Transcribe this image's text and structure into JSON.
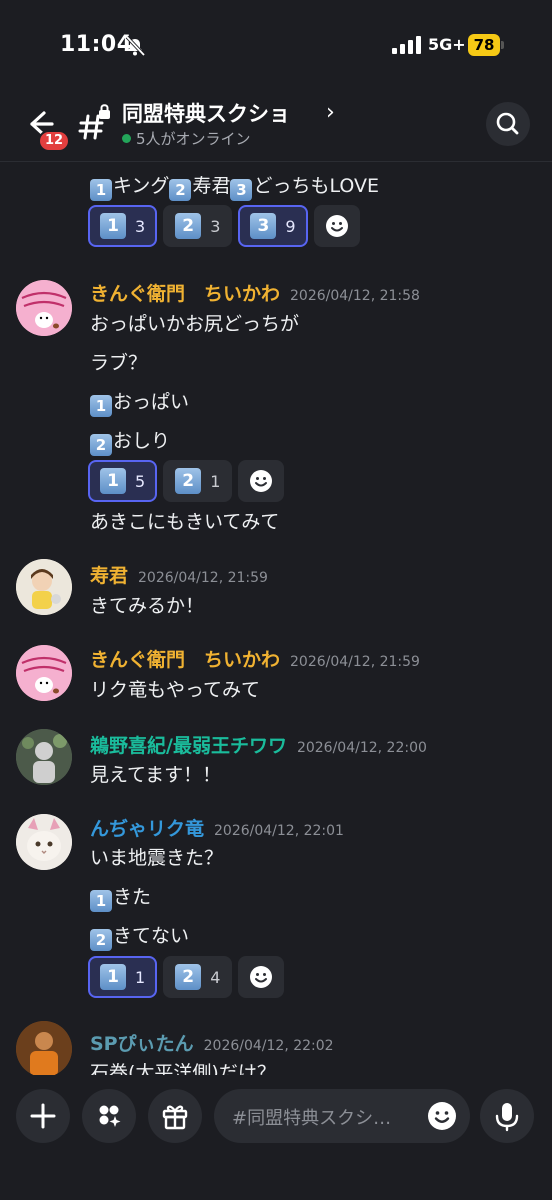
{
  "status": {
    "time": "11:04",
    "network": "5G+",
    "battery": "78"
  },
  "header": {
    "channel": "同盟特典スクショ",
    "chevron": "›",
    "online": "5人がオンライン",
    "badge": "12"
  },
  "messages": {
    "poll1": {
      "text_parts": [
        "キング",
        "寿君",
        "どっちもLOVE"
      ],
      "nums": [
        "1",
        "2",
        "3"
      ],
      "reactions": [
        {
          "n": "1",
          "count": "3",
          "me": true
        },
        {
          "n": "2",
          "count": "3",
          "me": false
        },
        {
          "n": "3",
          "count": "9",
          "me": true
        }
      ]
    },
    "m1": {
      "author": "きんぐ衛門　ちいかわ",
      "author_color": "#f0b232",
      "time": "2026/04/12, 21:58",
      "lines": [
        "おっぱいかお尻どっちが",
        "ラブ？",
        "おっぱい",
        "おしり"
      ],
      "nums": [
        "1",
        "2"
      ],
      "reactions": [
        {
          "n": "1",
          "count": "5",
          "me": true
        },
        {
          "n": "2",
          "count": "1",
          "me": false
        }
      ],
      "after": "あきこにもきいてみて"
    },
    "m2": {
      "author": "寿君",
      "author_color": "#f0b232",
      "time": "2026/04/12, 21:59",
      "text": "きてみるか！"
    },
    "m3": {
      "author": "きんぐ衛門　ちいかわ",
      "author_color": "#f0b232",
      "time": "2026/04/12, 21:59",
      "text": "リク竜もやってみて"
    },
    "m4": {
      "author": "鵜野喜紀/最弱王チワワ",
      "author_color": "#1abc9c",
      "time": "2026/04/12, 22:00",
      "text": "見えてます！！"
    },
    "m5": {
      "author": "んぢゃリク竜",
      "author_color": "#3498db",
      "time": "2026/04/12, 22:01",
      "lines": [
        "いま地震きた？",
        "きた",
        "きてない"
      ],
      "nums": [
        "1",
        "2"
      ],
      "reactions": [
        {
          "n": "1",
          "count": "1",
          "me": true
        },
        {
          "n": "2",
          "count": "4",
          "me": false
        }
      ]
    },
    "m6": {
      "author": "SPぴぃたん",
      "author_color": "#5b9bb0",
      "time": "2026/04/12, 22:02",
      "text": "石巻(太平洋側)だけ？"
    }
  },
  "composer": {
    "placeholder": "#同盟特典スクシ…"
  }
}
